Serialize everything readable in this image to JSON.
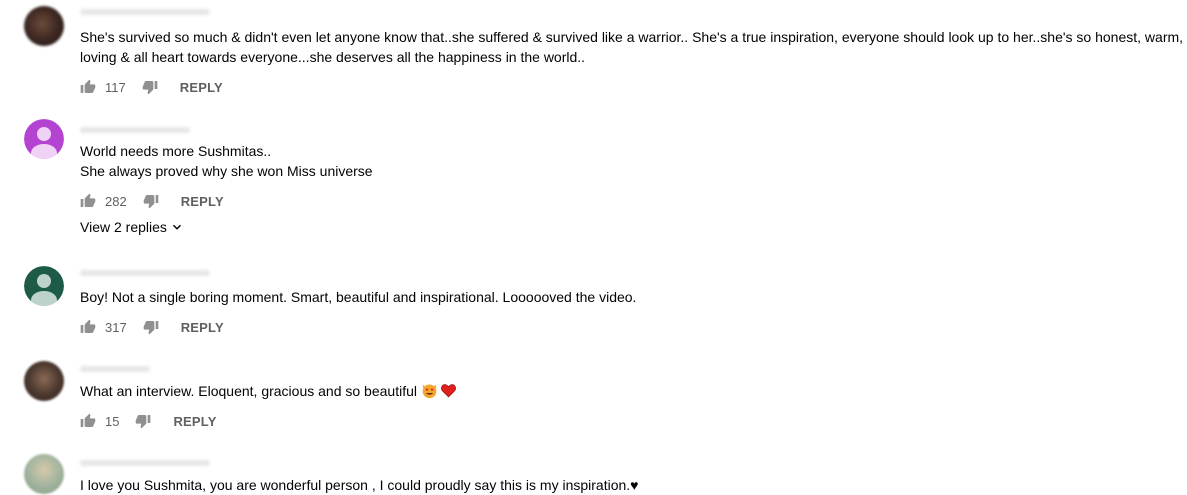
{
  "comments": [
    {
      "lines": [
        "She's survived so much & didn't even let anyone know that..she suffered & survived like a warrior.. She's a true inspiration, everyone should look up to her..she's so honest, warm,",
        "loving & all heart towards everyone...she deserves all the happiness in the world.."
      ],
      "likes": "117",
      "reply_label": "REPLY"
    },
    {
      "lines": [
        "World needs more Sushmitas..",
        "She always proved why she won Miss universe"
      ],
      "likes": "282",
      "reply_label": "REPLY",
      "view_replies": "View 2 replies",
      "avatar_color": "#b543d1"
    },
    {
      "lines": [
        "Boy! Not a single boring moment. Smart, beautiful and inspirational. Loooooved the video."
      ],
      "likes": "317",
      "reply_label": "REPLY",
      "avatar_color": "#1e5a48"
    },
    {
      "lines": [
        "What an interview. Eloquent, gracious and so beautiful"
      ],
      "likes": "15",
      "reply_label": "REPLY",
      "emojis": [
        "heart-eyes-cat-emoji",
        "red-heart-emoji"
      ]
    },
    {
      "lines": [
        "I love you Sushmita, you are wonderful person , I could proudly say this is my inspiration.♥"
      ]
    }
  ],
  "icons": {
    "like": "thumb-up-icon",
    "dislike": "thumb-down-icon",
    "expand": "chevron-down-icon"
  },
  "colors": {
    "text_primary": "#030303",
    "text_secondary": "#606060",
    "icon": "#909090"
  }
}
